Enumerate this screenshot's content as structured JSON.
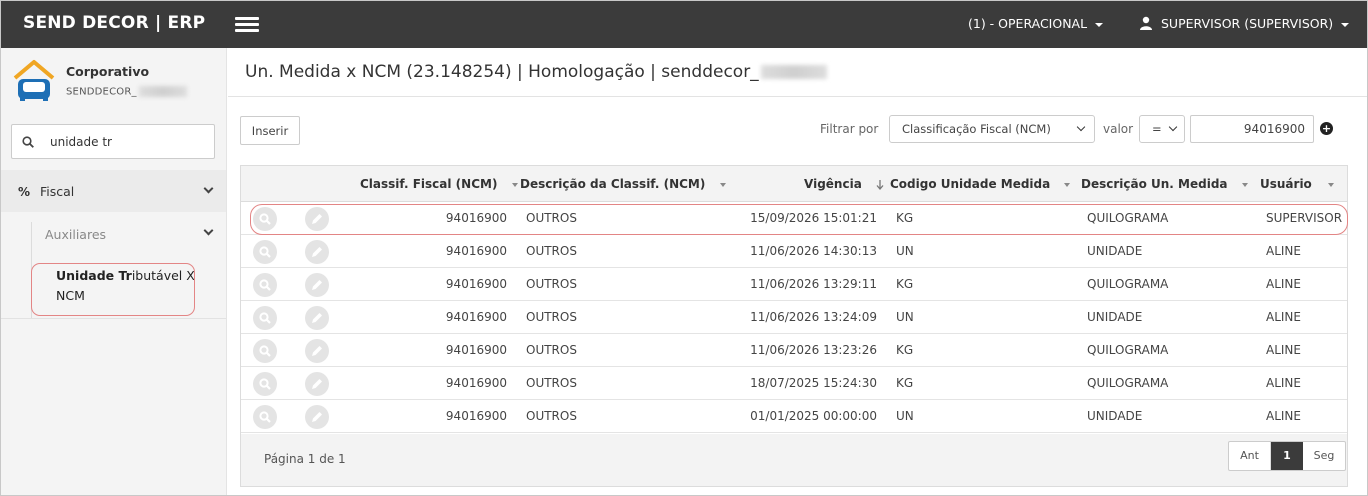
{
  "app": {
    "brand": "SEND DECOR | ERP"
  },
  "topbar": {
    "unit_label": "(1) - OPERACIONAL",
    "user_label": "SUPERVISOR (SUPERVISOR)"
  },
  "sidebar": {
    "company_name": "Corporativo",
    "company_code": "SENDDECOR_",
    "search_value": "unidade tr",
    "menu": {
      "fiscal_label": "Fiscal",
      "aux_label": "Auxiliares",
      "leaf_bold": "Unidade Tr",
      "leaf_rest": "ibutável X NCM"
    }
  },
  "main": {
    "title": "Un. Medida x NCM (23.148254) | Homologação | senddecor_",
    "insert_label": "Inserir",
    "filter_label": "Filtrar por",
    "filter_field": "Classificação Fiscal (NCM)",
    "valor_label": "valor",
    "operator": "=",
    "filter_value": "94016900"
  },
  "grid": {
    "columns": {
      "ncm": "Classif. Fiscal (NCM)",
      "desc_ncm": "Descrição da Classif. (NCM)",
      "vigencia": "Vigência",
      "cod_unidade": "Codigo Unidade Medida",
      "desc_unidade": "Descrição Un. Medida",
      "usuario": "Usuário"
    },
    "rows": [
      {
        "ncm": "94016900",
        "desc_ncm": "OUTROS",
        "vigencia": "15/09/2026 15:01:21",
        "cod_unidade": "KG",
        "desc_unidade": "QUILOGRAMA",
        "usuario": "SUPERVISOR"
      },
      {
        "ncm": "94016900",
        "desc_ncm": "OUTROS",
        "vigencia": "11/06/2026 14:30:13",
        "cod_unidade": "UN",
        "desc_unidade": "UNIDADE",
        "usuario": "ALINE"
      },
      {
        "ncm": "94016900",
        "desc_ncm": "OUTROS",
        "vigencia": "11/06/2026 13:29:11",
        "cod_unidade": "KG",
        "desc_unidade": "QUILOGRAMA",
        "usuario": "ALINE"
      },
      {
        "ncm": "94016900",
        "desc_ncm": "OUTROS",
        "vigencia": "11/06/2026 13:24:09",
        "cod_unidade": "UN",
        "desc_unidade": "UNIDADE",
        "usuario": "ALINE"
      },
      {
        "ncm": "94016900",
        "desc_ncm": "OUTROS",
        "vigencia": "11/06/2026 13:23:26",
        "cod_unidade": "KG",
        "desc_unidade": "QUILOGRAMA",
        "usuario": "ALINE"
      },
      {
        "ncm": "94016900",
        "desc_ncm": "OUTROS",
        "vigencia": "18/07/2025 15:24:30",
        "cod_unidade": "KG",
        "desc_unidade": "QUILOGRAMA",
        "usuario": "ALINE"
      },
      {
        "ncm": "94016900",
        "desc_ncm": "OUTROS",
        "vigencia": "01/01/2025 00:00:00",
        "cod_unidade": "UN",
        "desc_unidade": "UNIDADE",
        "usuario": "ALINE"
      }
    ],
    "footer": {
      "page_info": "Página 1 de 1",
      "prev_label": "Ant",
      "current_page": "1",
      "next_label": "Seg"
    }
  },
  "colors": {
    "topbar_bg": "#3b3b3b",
    "highlight": "#e38585",
    "logo_blue": "#1e6fb5",
    "logo_orange": "#f0a623"
  },
  "icons": [
    "menu-icon",
    "user-icon",
    "search-icon",
    "percent-icon",
    "magnifier-icon",
    "pencil-icon",
    "plus-circle-icon",
    "sort-down-icon"
  ]
}
